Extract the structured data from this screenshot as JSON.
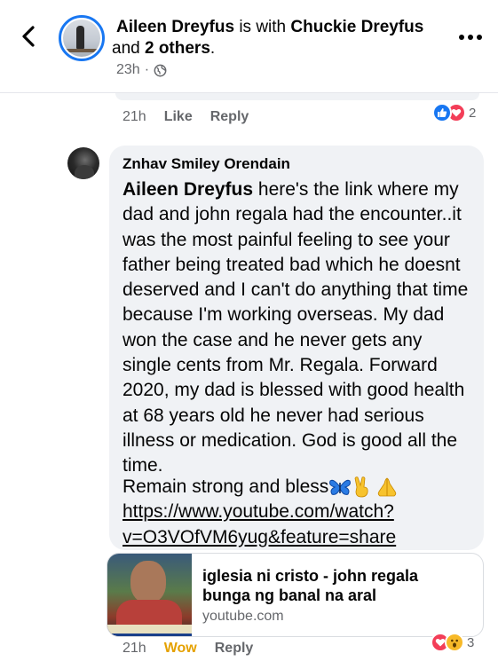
{
  "header": {
    "author": "Aileen Dreyfus",
    "connector": " is with ",
    "tagged": "Chuckie Dreyfus",
    "and_word": " and ",
    "others": "2 others",
    "period": ".",
    "time": "23h",
    "dot": "·"
  },
  "prev_comment": {
    "time": "21h",
    "like_label": "Like",
    "reply_label": "Reply",
    "reaction_count": "2",
    "reactions": [
      "like-icon",
      "love-icon"
    ]
  },
  "comment": {
    "author": "Znhav Smiley Orendain",
    "mention": "Aileen Dreyfus",
    "text": " here's the link where my dad and john regala had the encounter..it was the most painful feeling to see your father being treated bad which he doesnt deserved and I can't do anything that time because I'm working overseas. My dad won the case and he never gets any single cents from Mr. Regala. Forward 2020, my dad is blessed with good health at 68 years old he never had serious illness or medication. God is good all the time.",
    "closing": "Remain strong and bless",
    "emojis": [
      "butterfly-emoji",
      "victory-hand-emoji",
      "folded-hands-emoji"
    ],
    "link": "https://www.youtube.com/watch?v=O3VOfVM6yug&feature=share",
    "time": "21h",
    "reaction_label": "Wow",
    "reply_label": "Reply",
    "reaction_count": "3",
    "reactions": [
      "love-icon",
      "wow-icon"
    ]
  },
  "link_preview": {
    "title": "iglesia ni cristo - john regala bunga ng banal na aral",
    "domain": "youtube.com"
  },
  "colors": {
    "accent": "#1877f2",
    "wow_yellow": "#f7b928",
    "love_red": "#f33e58",
    "muted": "#65676b",
    "bubble": "#f0f2f5"
  }
}
